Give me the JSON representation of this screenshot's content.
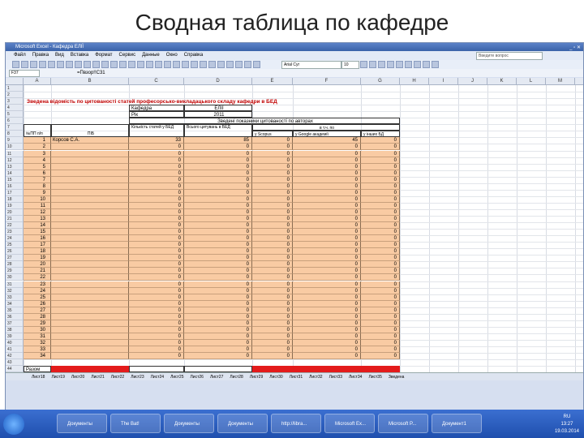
{
  "slide_title": "Сводная таблица по кафедре",
  "window": {
    "title": "Microsoft Excel - Кафедра ЕЛІЇ"
  },
  "menu": [
    "Файл",
    "Правка",
    "Вид",
    "Вставка",
    "Формат",
    "Сервис",
    "Данные",
    "Окно",
    "Справка"
  ],
  "help_box": "Введите вопрос",
  "toolbar": {
    "font": "Arial Cyr",
    "size": "10"
  },
  "formula_bar": {
    "namebox": "F37",
    "formula": "=Пвзор!!С31"
  },
  "columns": [
    "A",
    "B",
    "C",
    "D",
    "E",
    "F",
    "G",
    "H",
    "I",
    "J",
    "K",
    "L",
    "M",
    "N"
  ],
  "heading": "Зведена відомість по цитованості статей професорсько-викладацького складу кафедри в БЕД",
  "kafedra_label": "Кафедра",
  "kafedra_value": "ЕЛІЇ",
  "year_label": "Рік",
  "year_value": "2011",
  "summary_header": "Зведені показники цитованості по авторах",
  "col_headers": {
    "num": "№ПП п/п",
    "pib": "ПІБ",
    "count": "Кількість статей у БЕД",
    "total": "Всього цитувань в БЕД",
    "inc": "в т.ч. по",
    "scopus": "у Scopus",
    "google": "у Google академії",
    "other": "у інших БД"
  },
  "row_numbers": [
    "1",
    "2",
    "3",
    "4",
    "5",
    "6",
    "7",
    "8",
    "9",
    "10",
    "11",
    "12",
    "13",
    "14",
    "15",
    "16",
    "17",
    "18",
    "19",
    "20",
    "21",
    "22",
    "23",
    "24",
    "25",
    "26",
    "27",
    "28",
    "29",
    "30",
    "31",
    "32",
    "33",
    "34",
    "35",
    "36",
    "37",
    "38",
    "39",
    "40",
    "41",
    "42",
    "43",
    "44"
  ],
  "rows": [
    {
      "n": "1",
      "name": "Корсов С.А.",
      "c": "33",
      "t": "85",
      "e": "0",
      "f": "45",
      "g": "0"
    },
    {
      "n": "2",
      "name": "",
      "c": "0",
      "t": "0",
      "e": "0",
      "f": "0",
      "g": "0"
    },
    {
      "n": "3",
      "name": "",
      "c": "0",
      "t": "0",
      "e": "0",
      "f": "0",
      "g": "0"
    },
    {
      "n": "4",
      "name": "",
      "c": "0",
      "t": "0",
      "e": "0",
      "f": "0",
      "g": "0"
    },
    {
      "n": "5",
      "name": "",
      "c": "0",
      "t": "0",
      "e": "0",
      "f": "0",
      "g": "0"
    },
    {
      "n": "6",
      "name": "",
      "c": "0",
      "t": "0",
      "e": "0",
      "f": "0",
      "g": "0"
    },
    {
      "n": "7",
      "name": "",
      "c": "0",
      "t": "0",
      "e": "0",
      "f": "0",
      "g": "0"
    },
    {
      "n": "8",
      "name": "",
      "c": "0",
      "t": "0",
      "e": "0",
      "f": "0",
      "g": "0"
    },
    {
      "n": "9",
      "name": "",
      "c": "0",
      "t": "0",
      "e": "0",
      "f": "0",
      "g": "0"
    },
    {
      "n": "10",
      "name": "",
      "c": "0",
      "t": "0",
      "e": "0",
      "f": "0",
      "g": "0"
    },
    {
      "n": "11",
      "name": "",
      "c": "0",
      "t": "0",
      "e": "0",
      "f": "0",
      "g": "0"
    },
    {
      "n": "12",
      "name": "",
      "c": "0",
      "t": "0",
      "e": "0",
      "f": "0",
      "g": "0"
    },
    {
      "n": "13",
      "name": "",
      "c": "0",
      "t": "0",
      "e": "0",
      "f": "0",
      "g": "0"
    },
    {
      "n": "14",
      "name": "",
      "c": "0",
      "t": "0",
      "e": "0",
      "f": "0",
      "g": "0"
    },
    {
      "n": "15",
      "name": "",
      "c": "0",
      "t": "0",
      "e": "0",
      "f": "0",
      "g": "0"
    },
    {
      "n": "16",
      "name": "",
      "c": "0",
      "t": "0",
      "e": "0",
      "f": "0",
      "g": "0"
    },
    {
      "n": "17",
      "name": "",
      "c": "0",
      "t": "0",
      "e": "0",
      "f": "0",
      "g": "0"
    },
    {
      "n": "18",
      "name": "",
      "c": "0",
      "t": "0",
      "e": "0",
      "f": "0",
      "g": "0"
    },
    {
      "n": "19",
      "name": "",
      "c": "0",
      "t": "0",
      "e": "0",
      "f": "0",
      "g": "0"
    },
    {
      "n": "20",
      "name": "",
      "c": "0",
      "t": "0",
      "e": "0",
      "f": "0",
      "g": "0"
    },
    {
      "n": "21",
      "name": "",
      "c": "0",
      "t": "0",
      "e": "0",
      "f": "0",
      "g": "0"
    },
    {
      "n": "22",
      "name": "",
      "c": "0",
      "t": "0",
      "e": "0",
      "f": "0",
      "g": "0"
    },
    {
      "n": "23",
      "name": "",
      "c": "0",
      "t": "0",
      "e": "0",
      "f": "0",
      "g": "0"
    },
    {
      "n": "24",
      "name": "",
      "c": "0",
      "t": "0",
      "e": "0",
      "f": "0",
      "g": "0"
    },
    {
      "n": "25",
      "name": "",
      "c": "0",
      "t": "0",
      "e": "0",
      "f": "0",
      "g": "0"
    },
    {
      "n": "26",
      "name": "",
      "c": "0",
      "t": "0",
      "e": "0",
      "f": "0",
      "g": "0"
    },
    {
      "n": "27",
      "name": "",
      "c": "0",
      "t": "0",
      "e": "0",
      "f": "0",
      "g": "0"
    },
    {
      "n": "28",
      "name": "",
      "c": "0",
      "t": "0",
      "e": "0",
      "f": "0",
      "g": "0"
    },
    {
      "n": "29",
      "name": "",
      "c": "0",
      "t": "0",
      "e": "0",
      "f": "0",
      "g": "0"
    },
    {
      "n": "30",
      "name": "",
      "c": "0",
      "t": "0",
      "e": "0",
      "f": "0",
      "g": "0"
    },
    {
      "n": "31",
      "name": "",
      "c": "0",
      "t": "0",
      "e": "0",
      "f": "0",
      "g": "0"
    },
    {
      "n": "32",
      "name": "",
      "c": "0",
      "t": "0",
      "e": "0",
      "f": "0",
      "g": "0"
    },
    {
      "n": "33",
      "name": "",
      "c": "0",
      "t": "0",
      "e": "0",
      "f": "0",
      "g": "0"
    },
    {
      "n": "34",
      "name": "",
      "c": "0",
      "t": "0",
      "e": "0",
      "f": "0",
      "g": "0"
    }
  ],
  "total_label": "Разом",
  "sheet_tabs": [
    "Лист18",
    "Лист19",
    "Лист20",
    "Лист21",
    "Лист22",
    "Лист23",
    "Лист24",
    "Лист25",
    "Лист26",
    "Лист27",
    "Лист28",
    "Лист29",
    "Лист30",
    "Лист31",
    "Лист32",
    "Лист33",
    "Лист34",
    "Лист35",
    "Зведена"
  ],
  "taskbar": {
    "items": [
      "Документы",
      "The Bat!",
      "Документы",
      "Документы",
      "http://libra...",
      "Microsoft Ex...",
      "Microsoft P...",
      "Документ1"
    ],
    "lang": "RU",
    "time": "13:27",
    "date": "19.03.2014"
  },
  "colors": {
    "peach": "#f9cba3",
    "red": "#e31b1b",
    "heading": "#c00000"
  }
}
